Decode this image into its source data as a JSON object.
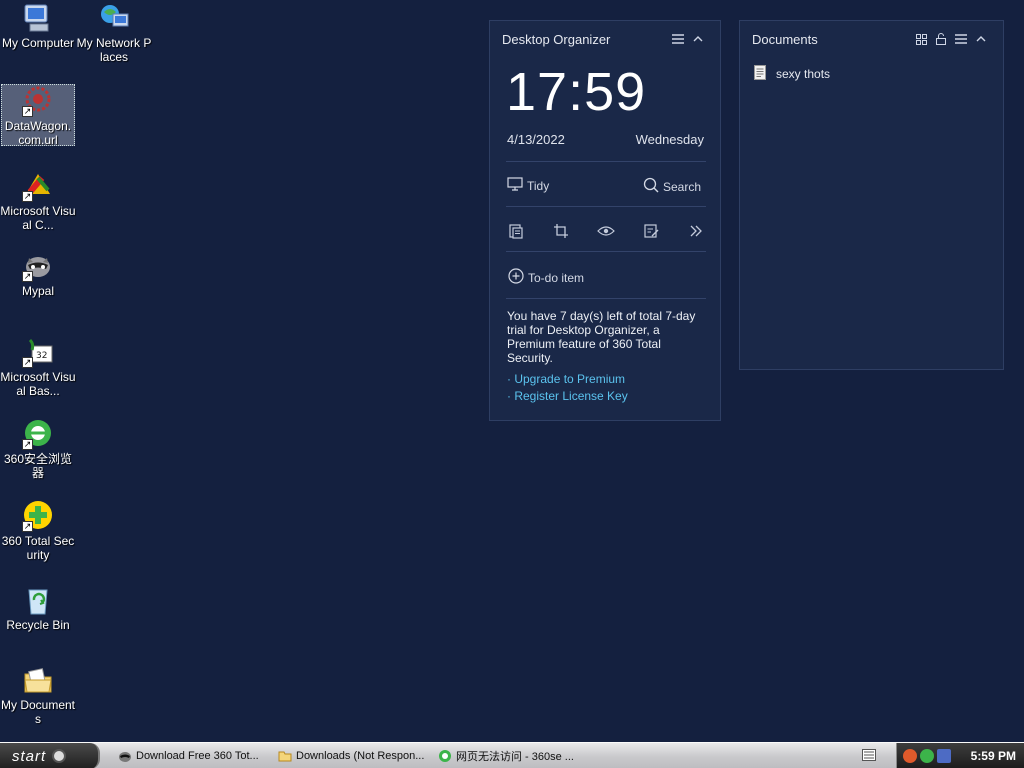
{
  "desktop": {
    "icons": [
      {
        "label": "My Computer"
      },
      {
        "label": "My Network Places"
      },
      {
        "label": "DataWagon.com.url"
      },
      {
        "label": "Microsoft Visual C..."
      },
      {
        "label": "Mypal"
      },
      {
        "label": "Microsoft Visual Bas..."
      },
      {
        "label": "360安全浏览器"
      },
      {
        "label": "360 Total Security"
      },
      {
        "label": "Recycle Bin"
      },
      {
        "label": "My Documents"
      }
    ]
  },
  "organizer": {
    "title": "Desktop Organizer",
    "time": "17:59",
    "date": "4/13/2022",
    "day": "Wednesday",
    "tidy_label": "Tidy",
    "search_label": "Search",
    "todo_label": "To-do item",
    "trial_text": "You have 7 day(s) left of total 7-day trial for Desktop Organizer, a Premium feature of 360 Total Security.",
    "upgrade_link": "· Upgrade to Premium",
    "register_link": "· Register License Key"
  },
  "documents": {
    "title": "Documents",
    "items": [
      {
        "label": "sexy thots"
      }
    ]
  },
  "taskbar": {
    "start_label": "start",
    "tasks": [
      {
        "label": "Download Free 360 Tot..."
      },
      {
        "label": "Downloads (Not Respon..."
      },
      {
        "label": "网页无法访问 - 360se ..."
      }
    ],
    "clock": "5:59 PM"
  },
  "colors": {
    "desktop_bg": "#14203f",
    "widget_bg": "#1a2848",
    "link": "#5bc3ee"
  }
}
